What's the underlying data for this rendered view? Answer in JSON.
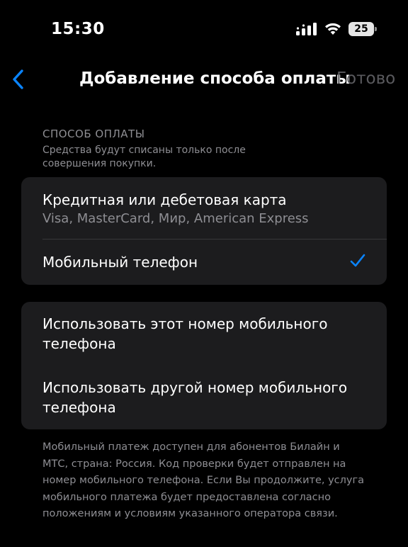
{
  "status_bar": {
    "time": "15:30",
    "battery_level": "25"
  },
  "nav": {
    "title": "Добавление способа оплаты",
    "done_label": "Готово",
    "accent_color": "#0a84ff",
    "back_icon": "chevron-left-icon"
  },
  "section": {
    "header": "СПОСОБ ОПЛАТЫ",
    "subtitle": "Средства будут списаны только после совершения покупки."
  },
  "payment_methods": [
    {
      "title": "Кредитная или дебетовая карта",
      "subtitle": "Visa, MasterCard, Мир, American Express",
      "selected": false
    },
    {
      "title": "Мобильный телефон",
      "selected": true,
      "check_icon": "checkmark-icon"
    }
  ],
  "phone_options": [
    {
      "title": "Использовать этот номер мобильного телефона"
    },
    {
      "title": "Использовать другой номер мобильного телефона"
    }
  ],
  "footer": {
    "text": "Мобильный платеж доступен для абонентов Билайн и МТС, страна: Россия. Код проверки будет отправлен на номер мобильного телефона. Если Вы продолжите, услуга мобильного платежа будет предоставлена согласно положениям и условиям указанного оператора связи."
  }
}
